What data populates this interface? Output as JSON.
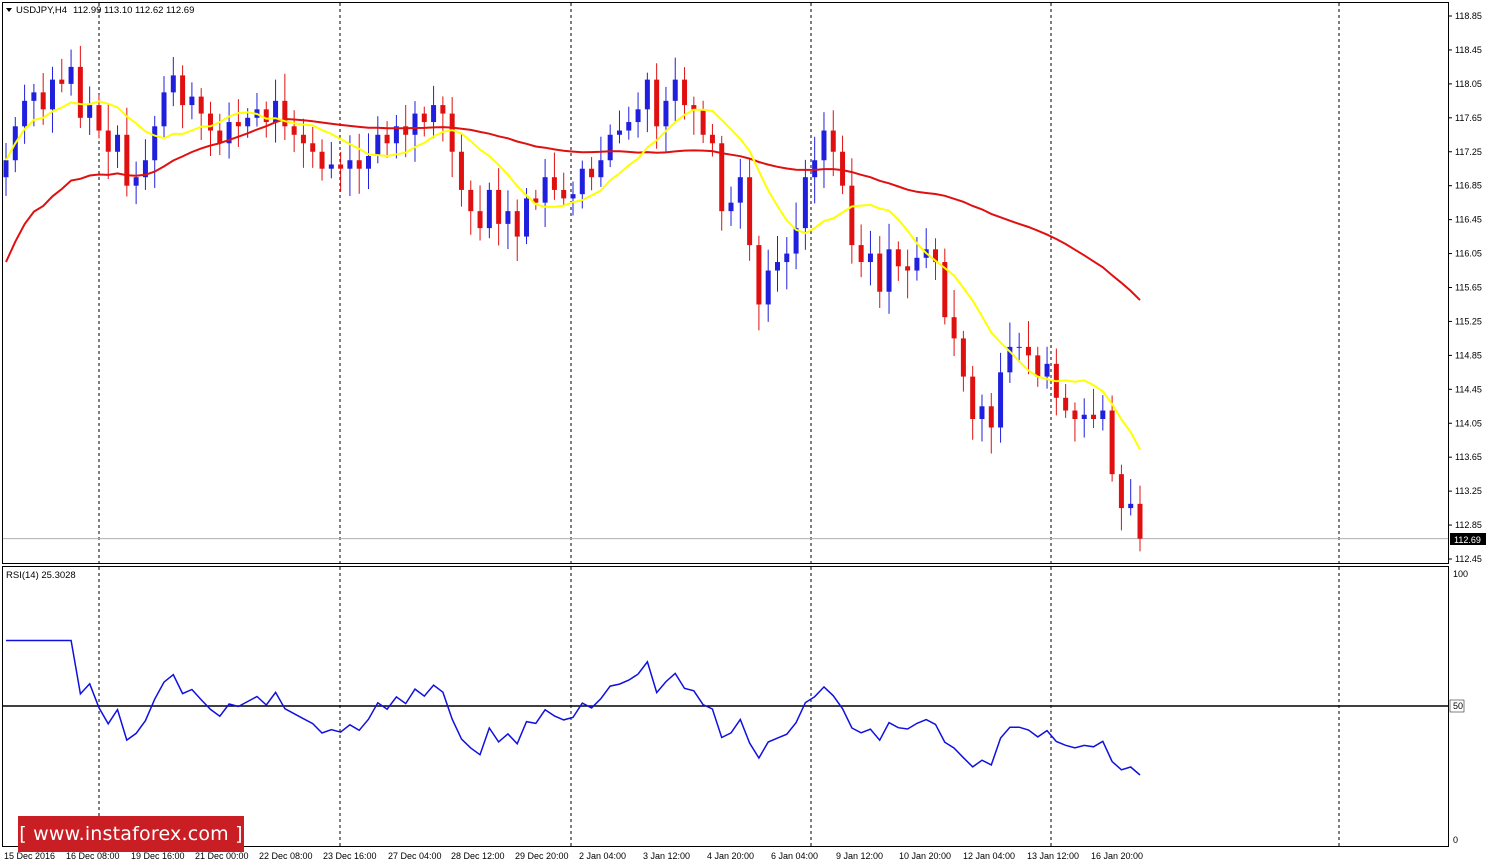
{
  "header": {
    "symbol": "USDJPY,H4",
    "ohlc": "112.99 113.10 112.62 112.69",
    "rsi_label": "RSI(14) 25.3028"
  },
  "watermark": "[ www.instaforex.com ]",
  "colors": {
    "bull": "#1f1fdd",
    "bear": "#e01010",
    "ma_fast": "#ffff00",
    "ma_slow": "#e01010",
    "rsi": "#1010e0",
    "price_line": "#b0b0b0"
  },
  "chart_data": {
    "type": "candlestick",
    "price_axis": {
      "min": 112.45,
      "max": 118.85,
      "ticks": [
        "118.85",
        "118.45",
        "118.05",
        "117.65",
        "117.25",
        "116.85",
        "116.45",
        "116.05",
        "115.65",
        "115.25",
        "114.85",
        "114.45",
        "114.05",
        "113.65",
        "113.25",
        "112.85",
        "112.45"
      ],
      "current": "112.69"
    },
    "rsi_axis": {
      "min": 0,
      "max": 100,
      "ticks": [
        "100",
        "50",
        "0"
      ],
      "level": 50
    },
    "time_labels": [
      "15 Dec 2016",
      "16 Dec 08:00",
      "19 Dec 16:00",
      "21 Dec 00:00",
      "22 Dec 08:00",
      "23 Dec 16:00",
      "27 Dec 04:00",
      "28 Dec 12:00",
      "29 Dec 20:00",
      "2 Jan 04:00",
      "3 Jan 12:00",
      "4 Jan 20:00",
      "6 Jan 04:00",
      "9 Jan 12:00",
      "10 Jan 20:00",
      "12 Jan 04:00",
      "13 Jan 12:00",
      "16 Jan 20:00"
    ],
    "closes": [
      117.15,
      117.55,
      117.85,
      117.95,
      117.75,
      118.1,
      118.05,
      118.25,
      117.65,
      117.8,
      117.5,
      117.25,
      117.45,
      116.85,
      116.95,
      117.15,
      117.55,
      117.95,
      118.15,
      117.8,
      117.9,
      117.7,
      117.5,
      117.35,
      117.6,
      117.55,
      117.65,
      117.75,
      117.6,
      117.85,
      117.55,
      117.45,
      117.35,
      117.25,
      117.05,
      117.1,
      117.05,
      117.15,
      117.05,
      117.2,
      117.45,
      117.35,
      117.55,
      117.45,
      117.7,
      117.6,
      117.8,
      117.7,
      117.25,
      116.8,
      116.55,
      116.35,
      116.8,
      116.4,
      116.55,
      116.25,
      116.7,
      116.65,
      116.95,
      116.8,
      116.7,
      116.75,
      117.05,
      116.95,
      117.15,
      117.45,
      117.5,
      117.6,
      117.75,
      118.1,
      117.55,
      117.85,
      118.1,
      117.8,
      117.75,
      117.45,
      117.35,
      116.55,
      116.65,
      116.95,
      116.15,
      115.45,
      115.85,
      115.95,
      116.05,
      116.35,
      116.95,
      117.15,
      117.5,
      117.25,
      116.85,
      116.15,
      115.95,
      116.05,
      115.6,
      116.1,
      115.9,
      115.85,
      116.0,
      116.1,
      115.95,
      115.3,
      115.05,
      114.6,
      114.1,
      114.25,
      114.0,
      114.65,
      114.95,
      114.95,
      114.85,
      114.6,
      114.75,
      114.35,
      114.2,
      114.1,
      114.15,
      114.1,
      114.2,
      113.45,
      113.05,
      113.1,
      112.69
    ],
    "ma_fast_label": "yellow MA",
    "ma_slow_label": "red MA"
  }
}
